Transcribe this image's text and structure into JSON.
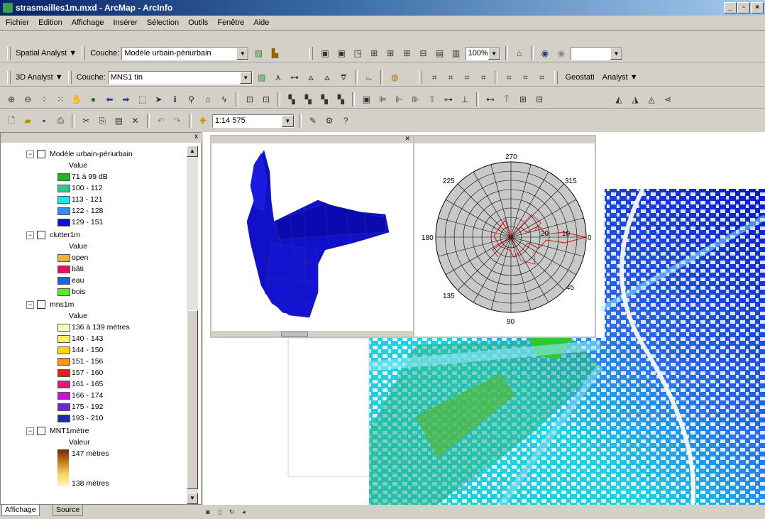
{
  "window": {
    "title": "strasmailles1m.mxd - ArcMap - ArcInfo",
    "minimize": "_",
    "maximize": "▫",
    "close": "×"
  },
  "menu": [
    "Fichier",
    "Edition",
    "Affichage",
    "Insérer",
    "Sélection",
    "Outils",
    "Fenêtre",
    "Aide"
  ],
  "toolbars": {
    "spatial": {
      "label": "Spatial Analyst ▼",
      "couche_label": "Couche:",
      "layer": "Modèle urbain-périurbain"
    },
    "threed": {
      "label": "3D Analyst ▼",
      "couche_label": "Couche:",
      "layer": "MNS1 tin",
      "geostat": "Geostati",
      "analyst": "Analyst ▼"
    },
    "zoom_value": "100%",
    "scale": "1:14 575"
  },
  "toc": {
    "close": "x",
    "layers": [
      {
        "name": "Modèle urbain-périurbain",
        "subtitle": "Value",
        "items": [
          {
            "label": "71 à 99 dB",
            "color": "#22b422"
          },
          {
            "label": "100 - 112",
            "color": "#2ecc8a"
          },
          {
            "label": "113 - 121",
            "color": "#1fe6e6"
          },
          {
            "label": "122 - 128",
            "color": "#3c8cf0"
          },
          {
            "label": "129 - 151",
            "color": "#0a14c8"
          }
        ]
      },
      {
        "name": "clutter1m",
        "subtitle": "Value",
        "items": [
          {
            "label": "open",
            "color": "#f0b23c"
          },
          {
            "label": "bâti",
            "color": "#e0145a"
          },
          {
            "label": "eau",
            "color": "#1e64dc"
          },
          {
            "label": "bois",
            "color": "#64e628"
          }
        ]
      },
      {
        "name": "mns1m",
        "subtitle": "Value",
        "items": [
          {
            "label": "136 à 139 mètres",
            "color": "#fffab4"
          },
          {
            "label": "140 - 143",
            "color": "#fff064"
          },
          {
            "label": "144 - 150",
            "color": "#ffd700"
          },
          {
            "label": "151 - 156",
            "color": "#f5961e"
          },
          {
            "label": "157 - 160",
            "color": "#e61e1e"
          },
          {
            "label": "161 - 165",
            "color": "#e6147d"
          },
          {
            "label": "166 - 174",
            "color": "#c814d2"
          },
          {
            "label": "175 - 192",
            "color": "#6e28c8"
          },
          {
            "label": "193 - 210",
            "color": "#1e28b4"
          }
        ]
      },
      {
        "name": "MNT1mètre",
        "subtitle": "Valeur",
        "ramp_high": "147 mètres",
        "ramp_low": "138 mètres"
      }
    ],
    "tabs": [
      "Affichage",
      "Source"
    ]
  },
  "polar": {
    "top": "270",
    "bottom": "90",
    "left": "180",
    "right": "0",
    "tl": "225",
    "tr": "315",
    "bl": "135",
    "br": "45",
    "r20": "20",
    "r10": "10"
  },
  "colors": {
    "accent": "#0a246a",
    "shape3d": "#1010c8"
  }
}
